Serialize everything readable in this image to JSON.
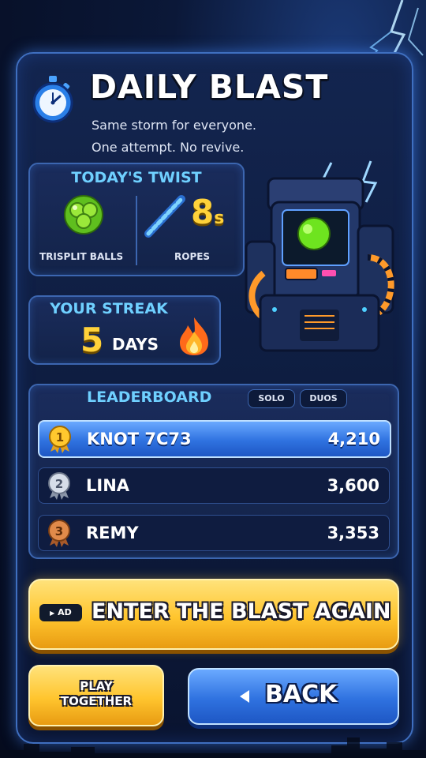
{
  "header": {
    "title": "DAILY BLAST",
    "subtitle_line1": "Same storm for everyone.",
    "subtitle_line2": "One attempt. No revive."
  },
  "twist": {
    "title": "TODAY'S TWIST",
    "ball_label": "TRISPLIT BALLS",
    "rope_label": "ROPES",
    "rope_time": "8",
    "rope_time_unit": "s"
  },
  "streak": {
    "title": "YOUR STREAK",
    "count": "5",
    "unit": "DAYS"
  },
  "leaderboard": {
    "title": "LEADERBOARD",
    "filters": [
      "SOLO",
      "DUOS"
    ],
    "rows": [
      {
        "rank": "1",
        "name": "KNOT 7C73",
        "score": "4,210",
        "medal": "gold"
      },
      {
        "rank": "2",
        "name": "LINA",
        "score": "3,600",
        "medal": "silver"
      },
      {
        "rank": "3",
        "name": "REMY",
        "score": "3,353",
        "medal": "bronze"
      }
    ]
  },
  "actions": {
    "ad_badge": "AD",
    "enter_label": "ENTER THE BLAST AGAIN",
    "play_line1": "PLAY",
    "play_line2": "TOGETHER",
    "back_label": "BACK"
  },
  "colors": {
    "accent_cyan": "#6fd0ff",
    "gold": "#ffd23a",
    "button_yellow": "#ffc52e",
    "button_blue": "#2f72e0",
    "panel_bg": "#0d1b3d"
  },
  "icons": [
    "stopwatch-icon",
    "trisplit-ball-icon",
    "rope-icon",
    "fire-icon",
    "arcade-machine-art",
    "gold-medal-icon",
    "silver-medal-icon",
    "bronze-medal-icon",
    "play-triangle-icon",
    "back-arrow-icon"
  ]
}
